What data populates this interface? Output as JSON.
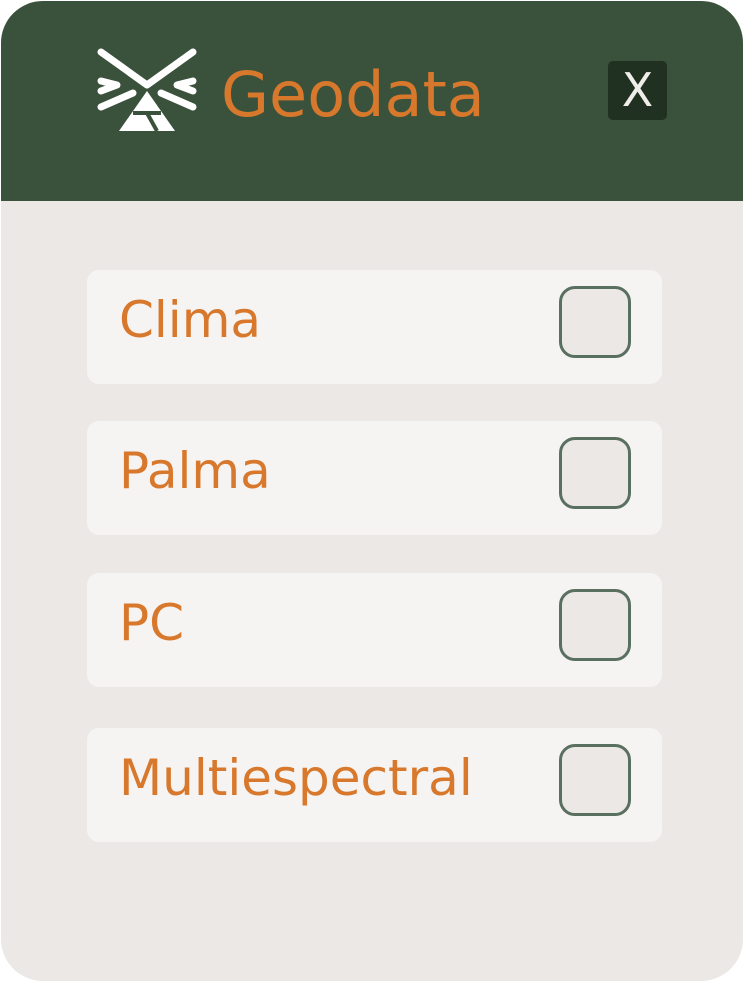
{
  "header": {
    "title": "Geodata",
    "close_label": "X",
    "logo_icon": "geodata-logo-icon",
    "close_icon": "close-icon"
  },
  "options": [
    {
      "label": "Clima",
      "checked": false
    },
    {
      "label": "Palma",
      "checked": false
    },
    {
      "label": "PC",
      "checked": false
    },
    {
      "label": "Multiespectral",
      "checked": false
    }
  ],
  "colors": {
    "header_bg": "#3a523b",
    "panel_bg": "#ebe8e5",
    "accent": "#d7782c",
    "item_bg": "#f6f4f3",
    "checkbox_border": "#596f5f",
    "close_bg": "#203021"
  }
}
